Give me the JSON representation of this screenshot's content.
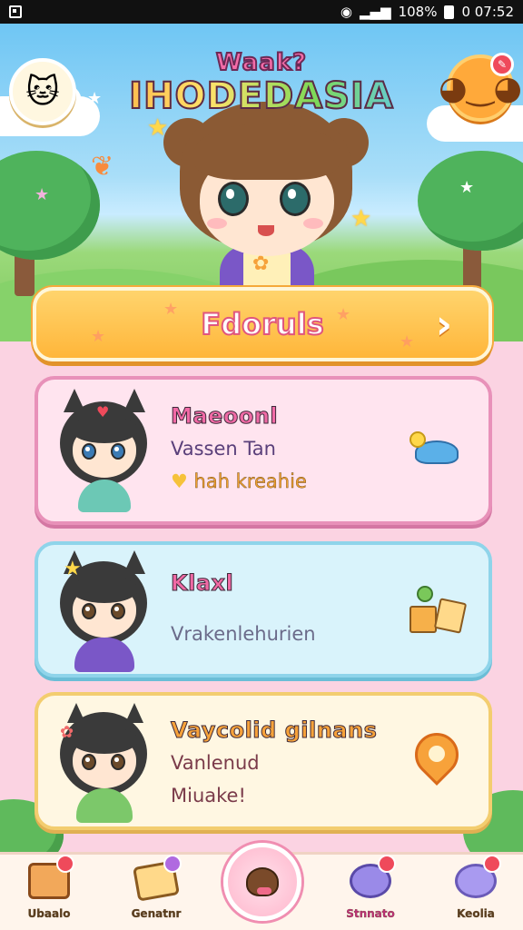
{
  "status_bar": {
    "battery": "108%",
    "time": "0 07:52"
  },
  "header": {
    "title_small": "Waak?",
    "title_big": "IHODEDASIA"
  },
  "primary_button": {
    "label": "Fdoruls",
    "chevron": "›"
  },
  "cards": [
    {
      "name": "Maeoonl",
      "line1": "Vassen Tan",
      "line2": "hah kreahie",
      "line2_icon": "♥",
      "name_color": "#f06aa5",
      "icon": "turtle-icon"
    },
    {
      "name": "Klaxl",
      "line1": "Vrakenlehurien",
      "name_color": "#f06aa5",
      "icon": "toy-blocks-icon"
    },
    {
      "name": "Vaycolid gilnans",
      "line1": "Vanlenud",
      "line2": "Miuake!",
      "name_color": "#f6a23a",
      "icon": "location-pin-icon"
    }
  ],
  "bottom_nav": {
    "items": [
      {
        "label": "Ubaalo",
        "icon": "chest-icon"
      },
      {
        "label": "Genatnr",
        "icon": "gift-box-icon"
      },
      {
        "label": "Stnnato",
        "icon": "chat-bubble-icon"
      },
      {
        "label": "Keolia",
        "icon": "chat-bubble-icon"
      }
    ],
    "center_icon": "puppy-icon"
  },
  "colors": {
    "accent_orange": "#ffb63a",
    "accent_pink": "#f06aa5",
    "card_pink": "#ffe4ef",
    "card_blue": "#d9f3fb",
    "card_cream": "#fff7e2"
  }
}
